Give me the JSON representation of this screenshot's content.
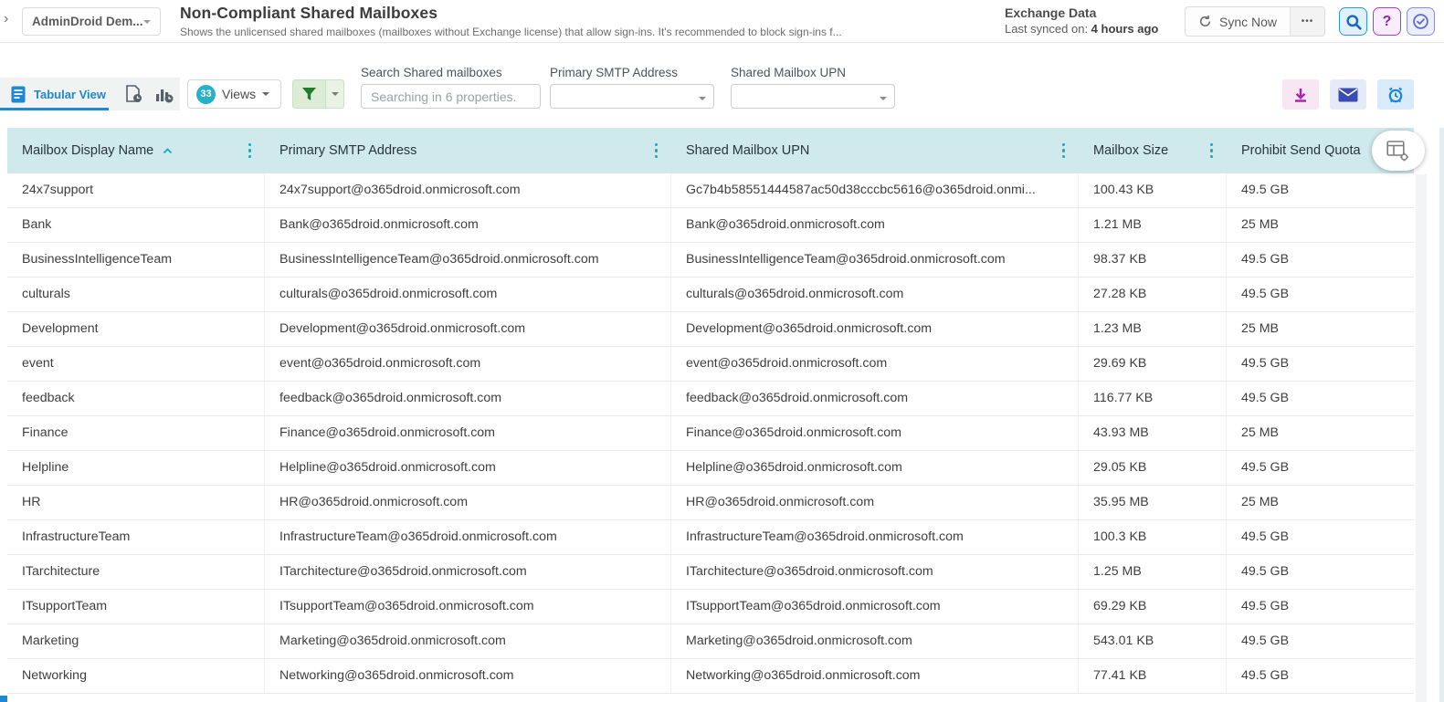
{
  "topbar": {
    "collapse_glyph": "›",
    "org_selector_label": "AdminDroid Dem...",
    "page_title": "Non-Compliant Shared Mailboxes",
    "page_subtitle": "Shows the unlicensed shared mailboxes (mailboxes without Exchange license) that allow sign-ins. It's recommended to block sign-ins f...",
    "data_source_name": "Exchange Data",
    "last_synced_label": "Last synced on: ",
    "last_synced_value": "4 hours ago",
    "sync_now_label": "Sync Now",
    "more_glyph": "•••",
    "help_glyph": "?"
  },
  "toolbar": {
    "tab_tabular_view": "Tabular View",
    "views_count": "33",
    "views_label": "Views",
    "search_label": "Search Shared mailboxes",
    "search_placeholder": "Searching in 6 properties.",
    "primary_smtp_label": "Primary SMTP Address",
    "shared_upn_label": "Shared Mailbox UPN"
  },
  "icons": [
    "tabular-view-icon",
    "report-schedule-icon",
    "chart-schedule-icon",
    "filter-funnel-icon",
    "sync-icon",
    "search-icon",
    "help-icon",
    "audit-check-icon",
    "download-icon",
    "email-icon",
    "alert-clock-icon",
    "column-chooser-icon",
    "sort-asc-icon",
    "column-menu-dots-icon"
  ],
  "colors": {
    "accent_teal": "#25b1c9",
    "tab_blue": "#1e88d2",
    "grid_header_bg": "#d0e9ed",
    "filter_green": "#1d7d2c",
    "download_magenta": "#a922ad",
    "mail_indigo": "#3a4cb1",
    "alert_blue": "#1c86d1",
    "help_purple": "#8e24aa"
  },
  "table": {
    "sort": {
      "column": "Mailbox Display Name",
      "direction": "ascending"
    },
    "columns": [
      "Mailbox Display Name",
      "Primary SMTP Address",
      "Shared Mailbox UPN",
      "Mailbox Size",
      "Prohibit Send Quota"
    ],
    "rows": [
      {
        "name": "24x7support",
        "smtp": "24x7support@o365droid.onmicrosoft.com",
        "upn": "Gc7b4b58551444587ac50d38cccbc5616@o365droid.onmi...",
        "size": "100.43 KB",
        "quota": "49.5 GB"
      },
      {
        "name": "Bank",
        "smtp": "Bank@o365droid.onmicrosoft.com",
        "upn": "Bank@o365droid.onmicrosoft.com",
        "size": "1.21 MB",
        "quota": "25 MB"
      },
      {
        "name": "BusinessIntelligenceTeam",
        "smtp": "BusinessIntelligenceTeam@o365droid.onmicrosoft.com",
        "upn": "BusinessIntelligenceTeam@o365droid.onmicrosoft.com",
        "size": "98.37 KB",
        "quota": "49.5 GB"
      },
      {
        "name": "culturals",
        "smtp": "culturals@o365droid.onmicrosoft.com",
        "upn": "culturals@o365droid.onmicrosoft.com",
        "size": "27.28 KB",
        "quota": "49.5 GB"
      },
      {
        "name": "Development",
        "smtp": "Development@o365droid.onmicrosoft.com",
        "upn": "Development@o365droid.onmicrosoft.com",
        "size": "1.23 MB",
        "quota": "25 MB"
      },
      {
        "name": "event",
        "smtp": "event@o365droid.onmicrosoft.com",
        "upn": "event@o365droid.onmicrosoft.com",
        "size": "29.69 KB",
        "quota": "49.5 GB"
      },
      {
        "name": "feedback",
        "smtp": "feedback@o365droid.onmicrosoft.com",
        "upn": "feedback@o365droid.onmicrosoft.com",
        "size": "116.77 KB",
        "quota": "49.5 GB"
      },
      {
        "name": "Finance",
        "smtp": "Finance@o365droid.onmicrosoft.com",
        "upn": "Finance@o365droid.onmicrosoft.com",
        "size": "43.93 MB",
        "quota": "25 MB"
      },
      {
        "name": "Helpline",
        "smtp": "Helpline@o365droid.onmicrosoft.com",
        "upn": "Helpline@o365droid.onmicrosoft.com",
        "size": "29.05 KB",
        "quota": "49.5 GB"
      },
      {
        "name": "HR",
        "smtp": "HR@o365droid.onmicrosoft.com",
        "upn": "HR@o365droid.onmicrosoft.com",
        "size": "35.95 MB",
        "quota": "25 MB"
      },
      {
        "name": "InfrastructureTeam",
        "smtp": "InfrastructureTeam@o365droid.onmicrosoft.com",
        "upn": "InfrastructureTeam@o365droid.onmicrosoft.com",
        "size": "100.3 KB",
        "quota": "49.5 GB"
      },
      {
        "name": "ITarchitecture",
        "smtp": "ITarchitecture@o365droid.onmicrosoft.com",
        "upn": "ITarchitecture@o365droid.onmicrosoft.com",
        "size": "1.25 MB",
        "quota": "49.5 GB"
      },
      {
        "name": "ITsupportTeam",
        "smtp": "ITsupportTeam@o365droid.onmicrosoft.com",
        "upn": "ITsupportTeam@o365droid.onmicrosoft.com",
        "size": "69.29 KB",
        "quota": "49.5 GB"
      },
      {
        "name": "Marketing",
        "smtp": "Marketing@o365droid.onmicrosoft.com",
        "upn": "Marketing@o365droid.onmicrosoft.com",
        "size": "543.01 KB",
        "quota": "49.5 GB"
      },
      {
        "name": "Networking",
        "smtp": "Networking@o365droid.onmicrosoft.com",
        "upn": "Networking@o365droid.onmicrosoft.com",
        "size": "77.41 KB",
        "quota": "49.5 GB"
      }
    ]
  }
}
